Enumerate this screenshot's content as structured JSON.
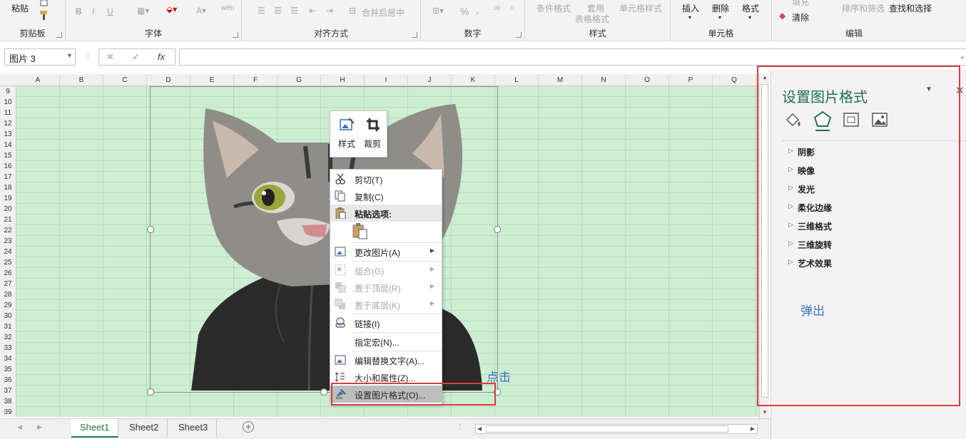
{
  "ribbon": {
    "paste": "粘贴",
    "clipboard_group": "剪贴板",
    "font_group": "字体",
    "alignment_group": "对齐方式",
    "merge_center": "合并后居中",
    "number_group": "数字",
    "percent": "%",
    "conditional_format": "条件格式",
    "table_format_line1": "套用",
    "table_format_line2": "表格格式",
    "cell_styles": "单元格样式",
    "styles_group": "样式",
    "insert": "插入",
    "delete": "删除",
    "format": "格式",
    "cells_group": "单元格",
    "fill": "填充",
    "clear": "清除",
    "sort_filter": "排序和筛选",
    "find_select": "查找和选择",
    "editing_group": "编辑",
    "bold": "B",
    "italic": "I",
    "underline": "U",
    "wen": "wén"
  },
  "formula_bar": {
    "name_box": "图片 3",
    "cancel": "✕",
    "enter": "✓",
    "fx": "fx",
    "content": ""
  },
  "grid": {
    "columns": [
      "A",
      "B",
      "C",
      "D",
      "E",
      "F",
      "G",
      "H",
      "I",
      "J",
      "K",
      "L",
      "M",
      "N",
      "O",
      "P",
      "Q"
    ],
    "rows": [
      "9",
      "10",
      "11",
      "12",
      "13",
      "14",
      "15",
      "16",
      "17",
      "18",
      "19",
      "20",
      "21",
      "22",
      "23",
      "24",
      "25",
      "26",
      "27",
      "28",
      "29",
      "30",
      "31",
      "32",
      "33",
      "34",
      "35",
      "36",
      "37",
      "38",
      "39"
    ],
    "grid_color": "#cdeed2"
  },
  "mini_toolbar": {
    "style": "样式",
    "crop": "裁剪"
  },
  "context_menu": {
    "cut": "剪切(T)",
    "copy": "复制(C)",
    "paste_options": "粘贴选项:",
    "change_picture": "更改图片(A)",
    "group": "组合(G)",
    "bring_front": "置于顶层(R)",
    "send_back": "置于底层(K)",
    "link": "链接(I)",
    "assign_macro": "指定宏(N)...",
    "edit_alt_text": "编辑替换文字(A)...",
    "size_props": "大小和属性(Z)...",
    "format_picture": "设置图片格式(O)..."
  },
  "sheets": {
    "tabs": [
      "Sheet1",
      "Sheet2",
      "Sheet3"
    ],
    "active": "Sheet1"
  },
  "pane": {
    "title": "设置图片格式",
    "sections": [
      "阴影",
      "映像",
      "发光",
      "柔化边缘",
      "三维格式",
      "三维旋转",
      "艺术效果"
    ]
  },
  "annotations": {
    "click": "点击",
    "popup": "弹出"
  },
  "colors": {
    "accent": "#217346",
    "highlight": "#e03a3a",
    "annotation": "#3f6fc4"
  }
}
